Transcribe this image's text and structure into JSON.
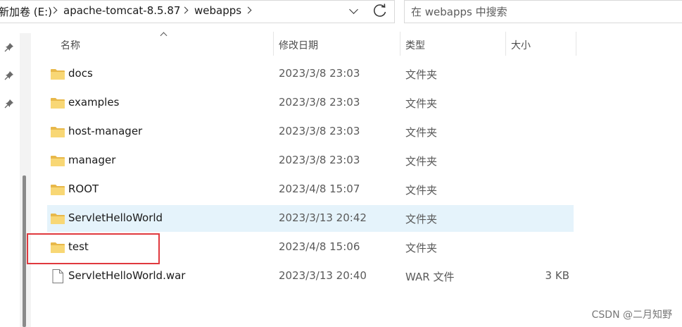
{
  "address_bar": {
    "crumbs": [
      "新加卷 (E:)",
      "apache-tomcat-8.5.87",
      "webapps"
    ],
    "search_placeholder": "在 webapps 中搜索"
  },
  "columns": {
    "name": "名称",
    "date": "修改日期",
    "type": "类型",
    "size": "大小"
  },
  "rows": [
    {
      "name": "docs",
      "date": "2023/3/8 23:03",
      "type": "文件夹",
      "size": "",
      "kind": "folder"
    },
    {
      "name": "examples",
      "date": "2023/3/8 23:03",
      "type": "文件夹",
      "size": "",
      "kind": "folder"
    },
    {
      "name": "host-manager",
      "date": "2023/3/8 23:03",
      "type": "文件夹",
      "size": "",
      "kind": "folder"
    },
    {
      "name": "manager",
      "date": "2023/3/8 23:03",
      "type": "文件夹",
      "size": "",
      "kind": "folder"
    },
    {
      "name": "ROOT",
      "date": "2023/4/8 15:07",
      "type": "文件夹",
      "size": "",
      "kind": "folder"
    },
    {
      "name": "ServletHelloWorld",
      "date": "2023/3/13 20:42",
      "type": "文件夹",
      "size": "",
      "kind": "folder",
      "selected": true
    },
    {
      "name": "test",
      "date": "2023/4/8 15:06",
      "type": "文件夹",
      "size": "",
      "kind": "folder",
      "highlighted": true
    },
    {
      "name": "ServletHelloWorld.war",
      "date": "2023/3/13 20:40",
      "type": "WAR 文件",
      "size": "3 KB",
      "kind": "file"
    }
  ],
  "watermark": "CSDN @二月知野",
  "colors": {
    "selection": "#e5f3fb",
    "highlight_box": "#e0393e",
    "folder": "#f8d775"
  },
  "icons": [
    "pin-icon",
    "folder-icon",
    "file-icon",
    "refresh-icon",
    "chevron-down-icon"
  ]
}
